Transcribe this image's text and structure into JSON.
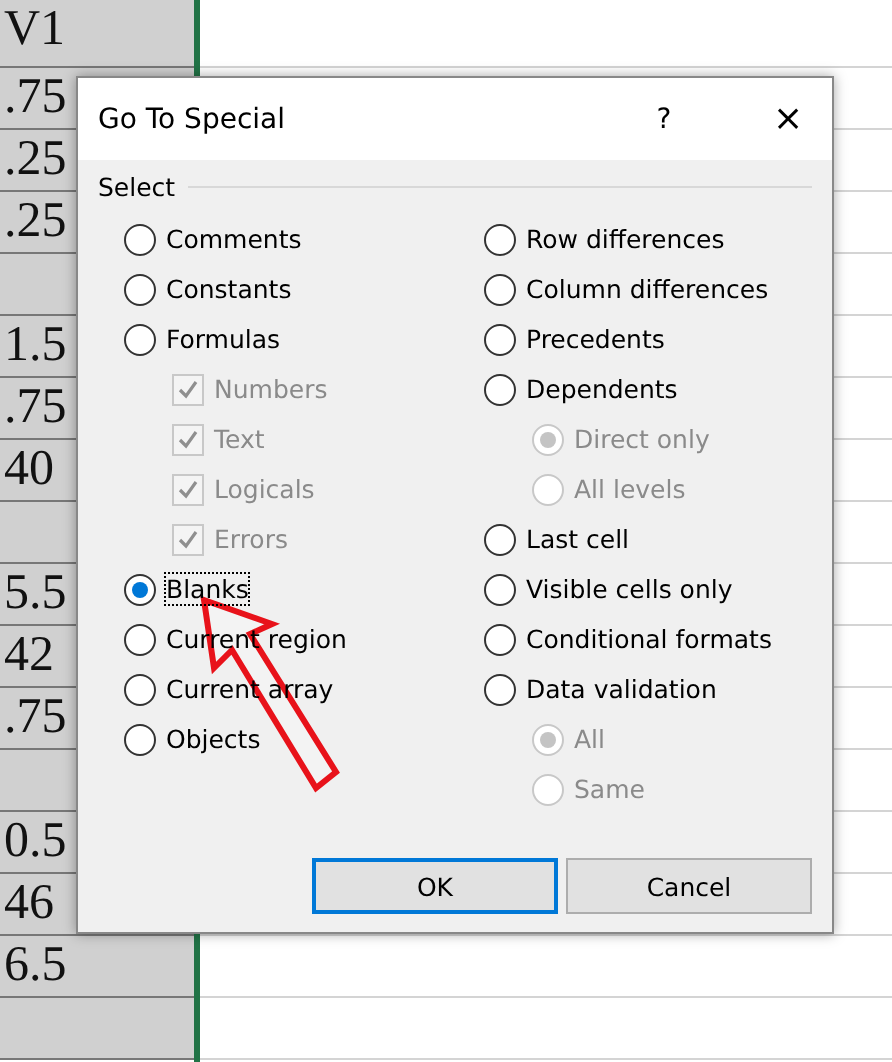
{
  "sheet": {
    "cells": [
      "V1",
      ".75",
      ".25",
      ".25",
      "",
      "1.5",
      ".75",
      "40",
      "",
      "5.5",
      "42",
      ".75",
      "",
      "0.5",
      "46",
      "6.5",
      ""
    ]
  },
  "dialog": {
    "title": "Go To Special",
    "help": "?",
    "close": "×",
    "group": "Select",
    "left": [
      {
        "kind": "radio",
        "label": "Comments",
        "selected": false
      },
      {
        "kind": "radio",
        "label": "Constants",
        "selected": false
      },
      {
        "kind": "radio",
        "label": "Formulas",
        "selected": false,
        "children": [
          {
            "kind": "check",
            "label": "Numbers",
            "checked": true,
            "disabled": true
          },
          {
            "kind": "check",
            "label": "Text",
            "checked": true,
            "disabled": true
          },
          {
            "kind": "check",
            "label": "Logicals",
            "checked": true,
            "disabled": true
          },
          {
            "kind": "check",
            "label": "Errors",
            "checked": true,
            "disabled": true
          }
        ]
      },
      {
        "kind": "radio",
        "label": "Blanks",
        "selected": true,
        "focused": true
      },
      {
        "kind": "radio",
        "label": "Current region",
        "selected": false
      },
      {
        "kind": "radio",
        "label": "Current array",
        "selected": false
      },
      {
        "kind": "radio",
        "label": "Objects",
        "selected": false
      }
    ],
    "right": [
      {
        "kind": "radio",
        "label": "Row differences",
        "selected": false
      },
      {
        "kind": "radio",
        "label": "Column differences",
        "selected": false
      },
      {
        "kind": "radio",
        "label": "Precedents",
        "selected": false
      },
      {
        "kind": "radio",
        "label": "Dependents",
        "selected": false,
        "children": [
          {
            "kind": "radio",
            "label": "Direct only",
            "selected": true,
            "disabled": true
          },
          {
            "kind": "radio",
            "label": "All levels",
            "selected": false,
            "disabled": true
          }
        ]
      },
      {
        "kind": "radio",
        "label": "Last cell",
        "selected": false
      },
      {
        "kind": "radio",
        "label": "Visible cells only",
        "selected": false
      },
      {
        "kind": "radio",
        "label": "Conditional formats",
        "selected": false
      },
      {
        "kind": "radio",
        "label": "Data validation",
        "selected": false,
        "children": [
          {
            "kind": "radio",
            "label": "All",
            "selected": true,
            "disabled": true
          },
          {
            "kind": "radio",
            "label": "Same",
            "selected": false,
            "disabled": true
          }
        ]
      }
    ],
    "buttons": [
      {
        "label": "OK",
        "default": true
      },
      {
        "label": "Cancel",
        "default": false
      }
    ]
  }
}
